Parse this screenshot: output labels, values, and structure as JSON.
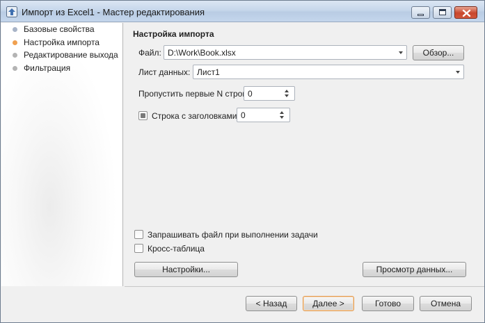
{
  "window": {
    "title": "Импорт из Excel1 - Мастер редактирования",
    "icon": "import-arrow-icon"
  },
  "nav": {
    "items": [
      {
        "label": "Базовые свойства",
        "dot_color": "#a8b4c8"
      },
      {
        "label": "Настройка импорта",
        "dot_color": "#f0a050"
      },
      {
        "label": "Редактирование выхода",
        "dot_color": "#b4b4b4"
      },
      {
        "label": "Фильтрация",
        "dot_color": "#b4b4b4"
      }
    ]
  },
  "main": {
    "section_title": "Настройка импорта",
    "file_label": "Файл:",
    "file_value": "D:\\Work\\Book.xlsx",
    "browse_button": "Обзор...",
    "sheet_label": "Лист данных:",
    "sheet_value": "Лист1",
    "skip_rows_label": "Пропустить первые N строк:",
    "skip_rows_value": "0",
    "header_row_label": "Строка с заголовками:",
    "header_row_value": "0",
    "ask_file_label": "Запрашивать файл при выполнении задачи",
    "cross_table_label": "Кросс-таблица",
    "settings_button": "Настройки...",
    "preview_button": "Просмотр данных..."
  },
  "footer": {
    "back": "< Назад",
    "next": "Далее >",
    "done": "Готово",
    "cancel": "Отмена"
  },
  "colors": {
    "accent": "#e29a4f",
    "titlebar": "#c7d7eb"
  }
}
